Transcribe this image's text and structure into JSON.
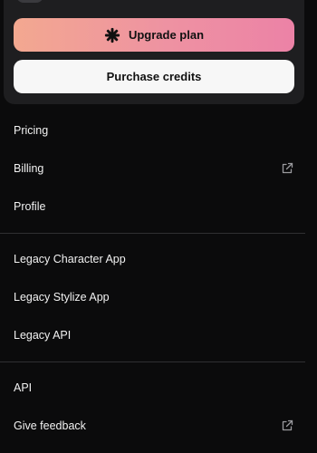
{
  "account_card": {
    "upgrade_label": "Upgrade plan",
    "purchase_label": "Purchase credits"
  },
  "menu": {
    "group1": [
      {
        "label": "Pricing"
      },
      {
        "label": "Billing",
        "icon": "external-link-icon"
      },
      {
        "label": "Profile"
      }
    ],
    "group2": [
      {
        "label": "Legacy Character App"
      },
      {
        "label": "Legacy Stylize App"
      },
      {
        "label": "Legacy API"
      }
    ],
    "group3": [
      {
        "label": "API"
      },
      {
        "label": "Give feedback",
        "icon": "external-link-icon"
      }
    ]
  },
  "colors": {
    "background": "#0b0b0c",
    "card": "#1e1e20",
    "upgrade_gradient_start": "#f3a890",
    "upgrade_gradient_end": "#ec82a6",
    "purchase_button": "#f7f7f7"
  }
}
